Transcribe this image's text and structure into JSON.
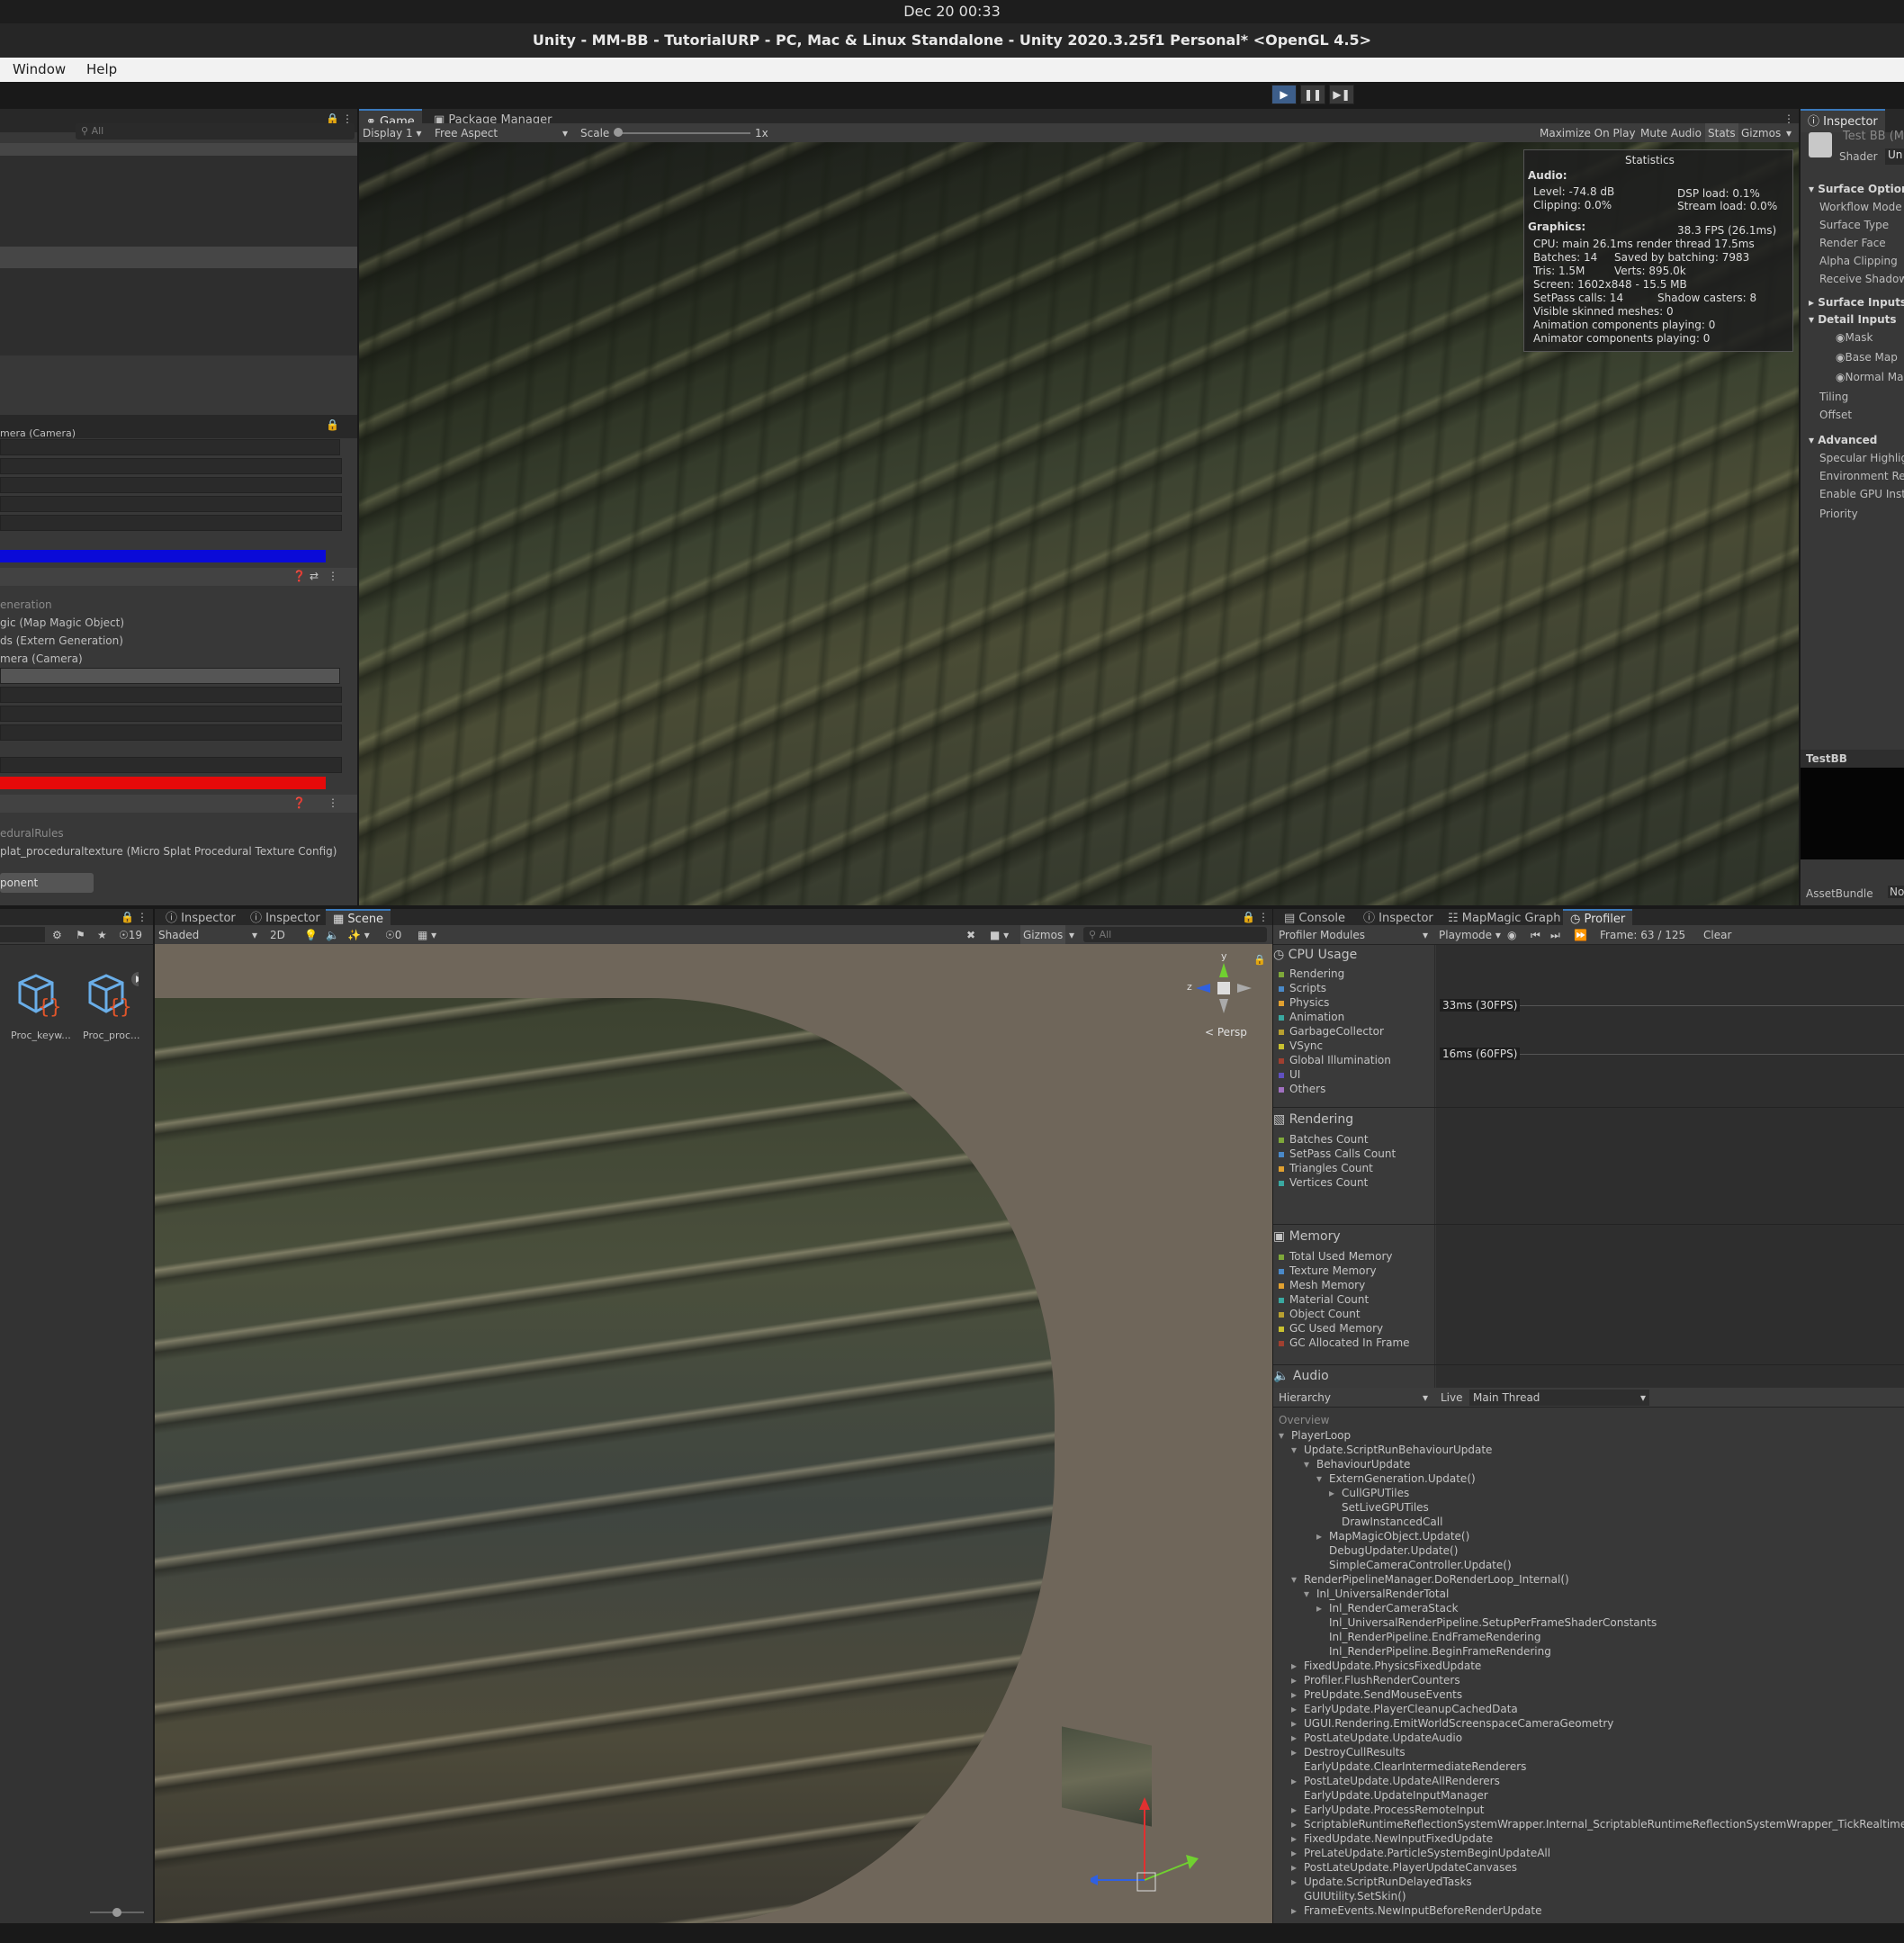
{
  "system": {
    "clock": "Dec 20  00:33"
  },
  "window": {
    "title": "Unity - MM-BB - TutorialURP - PC, Mac & Linux Standalone - Unity 2020.3.25f1 Personal* <OpenGL 4.5>"
  },
  "menu": {
    "items": [
      "Window",
      "Help"
    ]
  },
  "toolbar": {
    "play_icon": "play-icon",
    "pause_icon": "pause-icon",
    "step_icon": "step-icon"
  },
  "left_panel": {
    "search_placeholder": "All",
    "camera_field": "mera (Camera)",
    "event_header": "eneration",
    "event_rows": [
      "gic (Map Magic Object)",
      "ds (Extern Generation)",
      "mera (Camera)"
    ],
    "rules_header": "eduralRules",
    "rules_value": "plat_proceduraltexture (Micro Splat Procedural Texture Config)",
    "add_component": "ponent",
    "colors": {
      "blue": "#0a0ad8",
      "red": "#e60a0a"
    }
  },
  "game_view": {
    "tabs": [
      "Game",
      "Package Manager"
    ],
    "display": "Display 1",
    "aspect": "Free Aspect",
    "scale_label": "Scale",
    "scale_value": "1x",
    "options": [
      "Maximize On Play",
      "Mute Audio",
      "Stats",
      "Gizmos"
    ]
  },
  "stats": {
    "title": "Statistics",
    "audio_label": "Audio:",
    "level": "Level: -74.8 dB",
    "dsp": "DSP load: 0.1%",
    "clipping": "Clipping: 0.0%",
    "stream": "Stream load: 0.0%",
    "graphics_label": "Graphics:",
    "fps": "38.3 FPS (26.1ms)",
    "cpu": "CPU: main 26.1ms  render thread 17.5ms",
    "batches": "Batches: 14",
    "saved": "Saved by batching: 7983",
    "tris": "Tris: 1.5M",
    "verts": "Verts: 895.0k",
    "screen": "Screen: 1602x848 - 15.5 MB",
    "setpass": "SetPass calls: 14",
    "shadow": "Shadow casters: 8",
    "skinned": "Visible skinned meshes: 0",
    "animation": "Animation components playing: 0",
    "animator": "Animator components playing: 0"
  },
  "inspector_right": {
    "tab": "Inspector",
    "object": "Test BB (M",
    "shader_label": "Shader",
    "shader_value": "Un",
    "sections": [
      {
        "header": "Surface Options",
        "rows": [
          "Workflow Mode",
          "Surface Type",
          "Render Face",
          "Alpha Clipping",
          "Receive Shadow"
        ]
      },
      {
        "header": "Surface Inputs",
        "rows": []
      },
      {
        "header": "Detail Inputs",
        "rows": [
          "Mask",
          "Base Map",
          "Normal Map",
          "Tiling",
          "Offset"
        ]
      },
      {
        "header": "Advanced",
        "rows": [
          "Specular Highlig",
          "Environment Refl",
          "Enable GPU Insta",
          "Priority"
        ]
      }
    ],
    "preview_label": "TestBB",
    "assetbundle": "AssetBundle",
    "assetbundle_value": "No"
  },
  "project": {
    "count": "19",
    "assets": [
      {
        "label": "Proc_keyw..."
      },
      {
        "label": "Proc_proc..."
      }
    ]
  },
  "scene_view": {
    "tabs": [
      "Inspector",
      "Inspector",
      "Scene"
    ],
    "shading": "Shaded",
    "mode2d": "2D",
    "hidden_count": "0",
    "gizmos": "Gizmos",
    "search_placeholder": "All",
    "persp": "Persp",
    "axes": {
      "y": "y",
      "z": "z"
    }
  },
  "profiler": {
    "tabs": [
      "Console",
      "Inspector",
      "MapMagic Graph",
      "Profiler"
    ],
    "modules_label": "Profiler Modules",
    "playmode": "Playmode",
    "frame": "Frame: 63 / 125",
    "clear": "Clear",
    "cpu": {
      "title": "CPU Usage",
      "items": [
        {
          "name": "Rendering",
          "color": "#7ea83a"
        },
        {
          "name": "Scripts",
          "color": "#4a89c8"
        },
        {
          "name": "Physics",
          "color": "#e0a030"
        },
        {
          "name": "Animation",
          "color": "#3aa8a0"
        },
        {
          "name": "GarbageCollector",
          "color": "#b8a030"
        },
        {
          "name": "VSync",
          "color": "#c8c030"
        },
        {
          "name": "Global Illumination",
          "color": "#a04030"
        },
        {
          "name": "UI",
          "color": "#6050c0"
        },
        {
          "name": "Others",
          "color": "#a070c0"
        }
      ]
    },
    "markers": [
      "33ms (30FPS)",
      "16ms (60FPS)"
    ],
    "rendering": {
      "title": "Rendering",
      "items": [
        {
          "name": "Batches Count",
          "color": "#7ea83a"
        },
        {
          "name": "SetPass Calls Count",
          "color": "#4a89c8"
        },
        {
          "name": "Triangles Count",
          "color": "#e0a030"
        },
        {
          "name": "Vertices Count",
          "color": "#3aa8a0"
        }
      ]
    },
    "memory": {
      "title": "Memory",
      "items": [
        {
          "name": "Total Used Memory",
          "color": "#7ea83a"
        },
        {
          "name": "Texture Memory",
          "color": "#4a89c8"
        },
        {
          "name": "Mesh Memory",
          "color": "#e0a030"
        },
        {
          "name": "Material Count",
          "color": "#3aa8a0"
        },
        {
          "name": "Object Count",
          "color": "#b8a030"
        },
        {
          "name": "GC Used Memory",
          "color": "#c8c030"
        },
        {
          "name": "GC Allocated In Frame",
          "color": "#a04030"
        }
      ]
    },
    "audio_title": "Audio",
    "view_mode": "Hierarchy",
    "live": "Live",
    "thread": "Main Thread",
    "overview": "Overview",
    "tree": [
      {
        "t": "PlayerLoop",
        "d": 0,
        "a": "open"
      },
      {
        "t": "Update.ScriptRunBehaviourUpdate",
        "d": 1,
        "a": "open"
      },
      {
        "t": "BehaviourUpdate",
        "d": 2,
        "a": "open"
      },
      {
        "t": "ExternGeneration.Update()",
        "d": 3,
        "a": "open"
      },
      {
        "t": "CullGPUTiles",
        "d": 4,
        "a": "closed"
      },
      {
        "t": "SetLiveGPUTiles",
        "d": 4,
        "a": ""
      },
      {
        "t": "DrawInstancedCall",
        "d": 4,
        "a": ""
      },
      {
        "t": "MapMagicObject.Update()",
        "d": 3,
        "a": "closed"
      },
      {
        "t": "DebugUpdater.Update()",
        "d": 3,
        "a": ""
      },
      {
        "t": "SimpleCameraController.Update()",
        "d": 3,
        "a": ""
      },
      {
        "t": "RenderPipelineManager.DoRenderLoop_Internal()",
        "d": 1,
        "a": "open"
      },
      {
        "t": "Inl_UniversalRenderTotal",
        "d": 2,
        "a": "open"
      },
      {
        "t": "Inl_RenderCameraStack",
        "d": 3,
        "a": "closed"
      },
      {
        "t": "Inl_UniversalRenderPipeline.SetupPerFrameShaderConstants",
        "d": 3,
        "a": ""
      },
      {
        "t": "Inl_RenderPipeline.EndFrameRendering",
        "d": 3,
        "a": ""
      },
      {
        "t": "Inl_RenderPipeline.BeginFrameRendering",
        "d": 3,
        "a": ""
      },
      {
        "t": "FixedUpdate.PhysicsFixedUpdate",
        "d": 1,
        "a": "closed"
      },
      {
        "t": "Profiler.FlushRenderCounters",
        "d": 1,
        "a": "closed"
      },
      {
        "t": "PreUpdate.SendMouseEvents",
        "d": 1,
        "a": "closed"
      },
      {
        "t": "EarlyUpdate.PlayerCleanupCachedData",
        "d": 1,
        "a": "closed"
      },
      {
        "t": "UGUI.Rendering.EmitWorldScreenspaceCameraGeometry",
        "d": 1,
        "a": "closed"
      },
      {
        "t": "PostLateUpdate.UpdateAudio",
        "d": 1,
        "a": "closed"
      },
      {
        "t": "DestroyCullResults",
        "d": 1,
        "a": "closed"
      },
      {
        "t": "EarlyUpdate.ClearIntermediateRenderers",
        "d": 1,
        "a": ""
      },
      {
        "t": "PostLateUpdate.UpdateAllRenderers",
        "d": 1,
        "a": "closed"
      },
      {
        "t": "EarlyUpdate.UpdateInputManager",
        "d": 1,
        "a": ""
      },
      {
        "t": "EarlyUpdate.ProcessRemoteInput",
        "d": 1,
        "a": "closed"
      },
      {
        "t": "ScriptableRuntimeReflectionSystemWrapper.Internal_ScriptableRuntimeReflectionSystemWrapper_TickRealtimeProbes",
        "d": 1,
        "a": "closed"
      },
      {
        "t": "FixedUpdate.NewInputFixedUpdate",
        "d": 1,
        "a": "closed"
      },
      {
        "t": "PreLateUpdate.ParticleSystemBeginUpdateAll",
        "d": 1,
        "a": "closed"
      },
      {
        "t": "PostLateUpdate.PlayerUpdateCanvases",
        "d": 1,
        "a": "closed"
      },
      {
        "t": "Update.ScriptRunDelayedTasks",
        "d": 1,
        "a": "closed"
      },
      {
        "t": "GUIUtility.SetSkin()",
        "d": 1,
        "a": ""
      },
      {
        "t": "FrameEvents.NewInputBeforeRenderUpdate",
        "d": 1,
        "a": "closed"
      }
    ]
  }
}
